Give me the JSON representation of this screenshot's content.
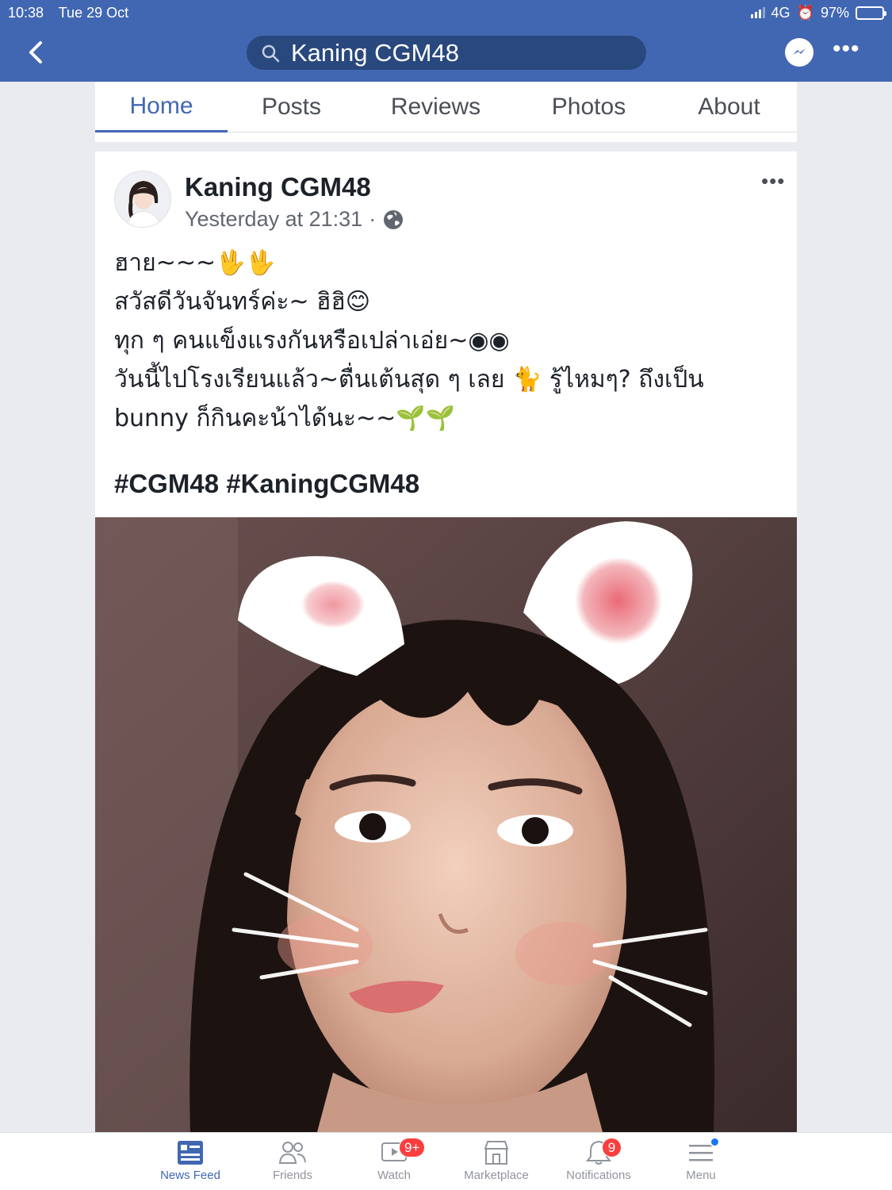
{
  "status_bar": {
    "time": "10:38",
    "date": "Tue 29 Oct",
    "network": "4G",
    "battery": "97%",
    "battery_level": 0.97
  },
  "header": {
    "search_value": "Kaning CGM48"
  },
  "tabs": [
    {
      "label": "Home",
      "active": true
    },
    {
      "label": "Posts",
      "active": false
    },
    {
      "label": "Reviews",
      "active": false
    },
    {
      "label": "Photos",
      "active": false
    },
    {
      "label": "About",
      "active": false
    }
  ],
  "post": {
    "author": "Kaning CGM48",
    "timestamp": "Yesterday at 21:31",
    "separator": "·",
    "lines": [
      "ฮาย~~~🖖🖖",
      "สวัสดีวันจันทร์ค่ะ~ ฮิฮิ😊",
      "ทุก ๆ คนแข็งแรงกันหรือเปล่าเอ่ย~◉◉",
      "วันนี้ไปโรงเรียนแล้ว~ตื่นเต้นสุด ๆ เลย 🐈 รู้ไหมๆ? ถึงเป็น",
      "bunny ก็กินคะน้าได้นะ~~🌱🌱"
    ],
    "hashtags": "#CGM48 #KaningCGM48"
  },
  "bottom_nav": [
    {
      "label": "News Feed",
      "icon": "news-feed-icon",
      "active": true
    },
    {
      "label": "Friends",
      "icon": "friends-icon",
      "active": false
    },
    {
      "label": "Watch",
      "icon": "watch-icon",
      "active": false,
      "badge": "9+"
    },
    {
      "label": "Marketplace",
      "icon": "marketplace-icon",
      "active": false
    },
    {
      "label": "Notifications",
      "icon": "bell-icon",
      "active": false,
      "badge": "9"
    },
    {
      "label": "Menu",
      "icon": "menu-icon",
      "active": false
    }
  ],
  "colors": {
    "brand": "#4267b2",
    "badge": "#fa3e3e",
    "text": "#1d2129",
    "muted": "#90949c"
  }
}
